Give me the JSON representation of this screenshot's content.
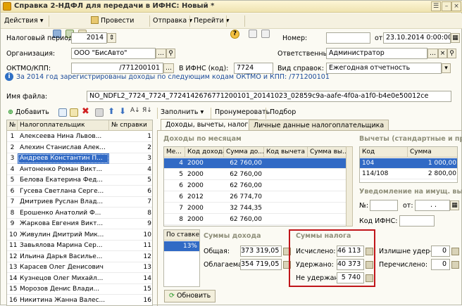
{
  "window": {
    "title": "Справка 2-НДФЛ для передачи в ИФНС: Новый *"
  },
  "toolbar": {
    "actions": "Действия",
    "post": "Провести",
    "send": "Отправка",
    "goto": "Перейти",
    "help": "?"
  },
  "form": {
    "period_label": "Налоговый период:",
    "period_value": "2014",
    "number_label": "Номер:",
    "date_label": "от:",
    "date_value": "23.10.2014  0:00:00",
    "org_label": "Организация:",
    "org_value": "ООО \"БисАвто\"",
    "resp_label": "Ответственный:",
    "resp_value": "Администратор",
    "oktmo_label": "ОКТМО/КПП:",
    "oktmo_value": "/771200101",
    "ifns_label": "В ИФНС (код):",
    "ifns_value": "7724",
    "kind_label": "Вид справок:",
    "kind_value": "Ежегодная отчетность",
    "info_text": "За 2014 год зарегистрированы доходы по следующим кодам ОКТМО и КПП: /771200101",
    "file_label": "Имя файла:",
    "file_value": "NO_NDFL2_7724_7724_7724142676771200101_20141023_02859c9a-aafe-4f0a-a1f0-b4e0e50012ce"
  },
  "list_toolbar": {
    "add": "Добавить",
    "fill": "Заполнить",
    "renumber": "Пронумеровать",
    "select": "Подбор"
  },
  "employees": {
    "headers": [
      "№",
      "Налогоплательщик",
      "№ справки"
    ],
    "rows": [
      {
        "n": "1",
        "name": "Алексеева Нина Львов...",
        "ref": "1"
      },
      {
        "n": "2",
        "name": "Алехин Станислав Алек...",
        "ref": "2"
      },
      {
        "n": "3",
        "name": "Андреев Константин П...",
        "ref": "3"
      },
      {
        "n": "4",
        "name": "Антоненко Роман Викт...",
        "ref": "4"
      },
      {
        "n": "5",
        "name": "Белова Екатерина Фед...",
        "ref": "5"
      },
      {
        "n": "6",
        "name": "Гусева Светлана Серге...",
        "ref": "6"
      },
      {
        "n": "7",
        "name": "Дмитриев Руслан Влад...",
        "ref": "7"
      },
      {
        "n": "8",
        "name": "Ерошенко Анатолий Ф...",
        "ref": "8"
      },
      {
        "n": "9",
        "name": "Жаркова Евгения Викт...",
        "ref": "9"
      },
      {
        "n": "10",
        "name": "Живулин Дмитрий Мик...",
        "ref": "10"
      },
      {
        "n": "11",
        "name": "Завьялова Марина Сер...",
        "ref": "11"
      },
      {
        "n": "12",
        "name": "Ильина Дарья Василье...",
        "ref": "12"
      },
      {
        "n": "13",
        "name": "Карасев Олег Денисович",
        "ref": "13"
      },
      {
        "n": "14",
        "name": "Кузнецов Олег Михайл...",
        "ref": "14"
      },
      {
        "n": "15",
        "name": "Морозов Денис Влади...",
        "ref": "15"
      },
      {
        "n": "16",
        "name": "Никитина Жанна Валес...",
        "ref": "16"
      }
    ]
  },
  "tabs": {
    "income": "Доходы, вычеты, налоги",
    "personal": "Личные данные налогоплательщика"
  },
  "income_by_month": {
    "group": "Доходы по месяцам",
    "headers": [
      "Ме...",
      "Код дохода",
      "Сумма до...",
      "Код вычета",
      "Сумма вы..."
    ],
    "rows": [
      {
        "m": "4",
        "code": "2000",
        "sum": "62 760,00"
      },
      {
        "m": "5",
        "code": "2000",
        "sum": "62 760,00"
      },
      {
        "m": "6",
        "code": "2000",
        "sum": "62 760,00"
      },
      {
        "m": "6",
        "code": "2012",
        "sum": "26 774,70"
      },
      {
        "m": "7",
        "code": "2000",
        "sum": "32 744,35"
      },
      {
        "m": "8",
        "code": "2000",
        "sum": "62 760,00"
      }
    ]
  },
  "deductions": {
    "group": "Вычеты (стандартные и пр.)",
    "headers": [
      "Код",
      "Сумма"
    ],
    "rows": [
      {
        "code": "104",
        "sum": "1 000,00"
      },
      {
        "code": "114/108",
        "sum": "2 800,00"
      },
      {
        "code": "",
        "sum": ""
      }
    ]
  },
  "property": {
    "group": "Уведомление на имущ. выч",
    "no_label": "№:",
    "from_label": "от:",
    "date_placeholder": ". .",
    "ifns_label": "Код ИФНС:"
  },
  "rates": {
    "header": "По ставке",
    "rate": "13%"
  },
  "income_sums": {
    "group": "Суммы дохода",
    "total_label": "Общая:",
    "total": "373 319,05",
    "taxable_label": "Облагаемая:",
    "taxable": "354 719,05"
  },
  "tax_sums": {
    "group": "Суммы налога",
    "calc_label": "Исчислено:",
    "calc": "46 113",
    "withheld_label": "Удержано:",
    "withheld": "40 373",
    "not_withheld_label": "Не удержано:",
    "not_withheld": "5 740"
  },
  "extra": {
    "excess_label": "Излишне удер-но:",
    "excess": "0",
    "transferred_label": "Перечислено:",
    "transferred": "0"
  },
  "refresh": "Обновить",
  "colors": {
    "highlight": "#c0151a",
    "selected_row": "#316ac5"
  }
}
